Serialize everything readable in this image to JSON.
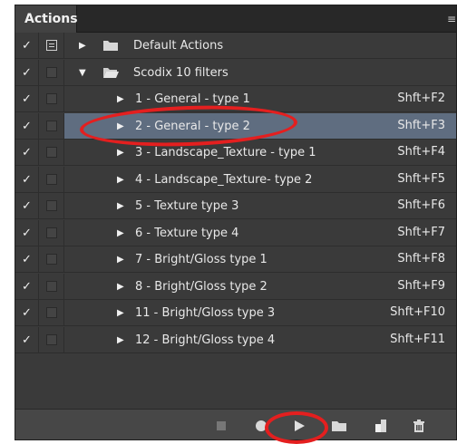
{
  "panel": {
    "tab_label": "Actions",
    "menu_icon": "panel-menu-icon"
  },
  "rows": [
    {
      "label": "Default Actions",
      "shortcut": "",
      "type": "set",
      "expanded": false,
      "checked": true,
      "dialog": true
    },
    {
      "label": "Scodix 10 filters",
      "shortcut": "",
      "type": "set",
      "expanded": true,
      "checked": true,
      "dialog": false
    },
    {
      "label": "1 - General - type 1",
      "shortcut": "Shft+F2",
      "type": "action",
      "checked": true,
      "dialog": false
    },
    {
      "label": "2 - General - type 2",
      "shortcut": "Shft+F3",
      "type": "action",
      "checked": true,
      "dialog": false,
      "selected": true
    },
    {
      "label": "3 - Landscape_Texture - type 1",
      "shortcut": "Shft+F4",
      "type": "action",
      "checked": true,
      "dialog": false
    },
    {
      "label": "4 - Landscape_Texture- type 2",
      "shortcut": "Shft+F5",
      "type": "action",
      "checked": true,
      "dialog": false
    },
    {
      "label": "5 - Texture type 3",
      "shortcut": "Shft+F6",
      "type": "action",
      "checked": true,
      "dialog": false
    },
    {
      "label": "6 - Texture type 4",
      "shortcut": "Shft+F7",
      "type": "action",
      "checked": true,
      "dialog": false
    },
    {
      "label": "7 - Bright/Gloss type 1",
      "shortcut": "Shft+F8",
      "type": "action",
      "checked": true,
      "dialog": false
    },
    {
      "label": "8 - Bright/Gloss type 2",
      "shortcut": "Shft+F9",
      "type": "action",
      "checked": true,
      "dialog": false
    },
    {
      "label": "11 - Bright/Gloss type 3",
      "shortcut": "Shft+F10",
      "type": "action",
      "checked": true,
      "dialog": false
    },
    {
      "label": "12 - Bright/Gloss type 4",
      "shortcut": "Shft+F11",
      "type": "action",
      "checked": true,
      "dialog": false
    }
  ],
  "glyphs": {
    "check": "✓",
    "triangle_right": "▶",
    "triangle_down": "▼",
    "menu": "≡"
  },
  "footer": {
    "buttons": [
      {
        "name": "stop-button",
        "icon": "stop-icon"
      },
      {
        "name": "record-button",
        "icon": "record-icon"
      },
      {
        "name": "play-button",
        "icon": "play-icon"
      },
      {
        "name": "new-set-button",
        "icon": "folder-icon"
      },
      {
        "name": "new-action-button",
        "icon": "new-page-icon"
      },
      {
        "name": "delete-button",
        "icon": "trash-icon"
      }
    ]
  },
  "colors": {
    "panel_bg": "#535353",
    "row_bg": "#3a3a3a",
    "selected_bg": "#5f6d80",
    "highlight": "#e41f1f"
  }
}
